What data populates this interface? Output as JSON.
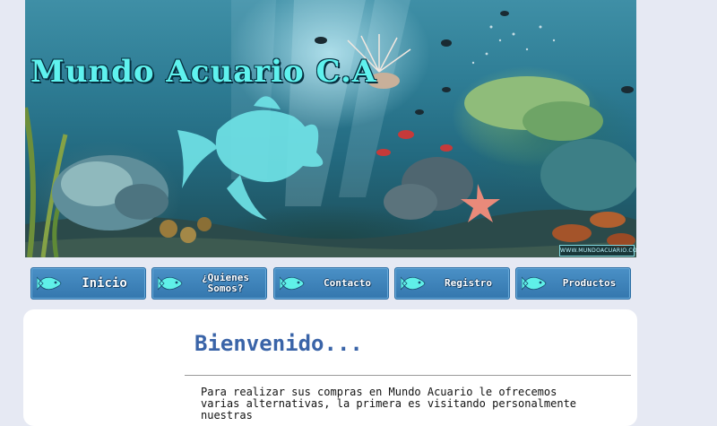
{
  "banner": {
    "title": "Mundo Acuario C.A",
    "url_text": "WWW.MUNDOACUARIO.COM"
  },
  "nav": {
    "items": [
      {
        "label": "Inicio"
      },
      {
        "label": "¿Quienes Somos?"
      },
      {
        "label": "Contacto"
      },
      {
        "label": "Registro"
      },
      {
        "label": "Productos"
      }
    ]
  },
  "content": {
    "heading": "Bienvenido...",
    "intro": "Para realizar sus compras en Mundo Acuario le ofrecemos varias alternativas, la primera es visitando personalmente nuestras"
  },
  "colors": {
    "page_bg": "#e6e9f3",
    "nav_button": "#3f84bc",
    "heading": "#3a64a8",
    "title": "#5ff2ee"
  }
}
